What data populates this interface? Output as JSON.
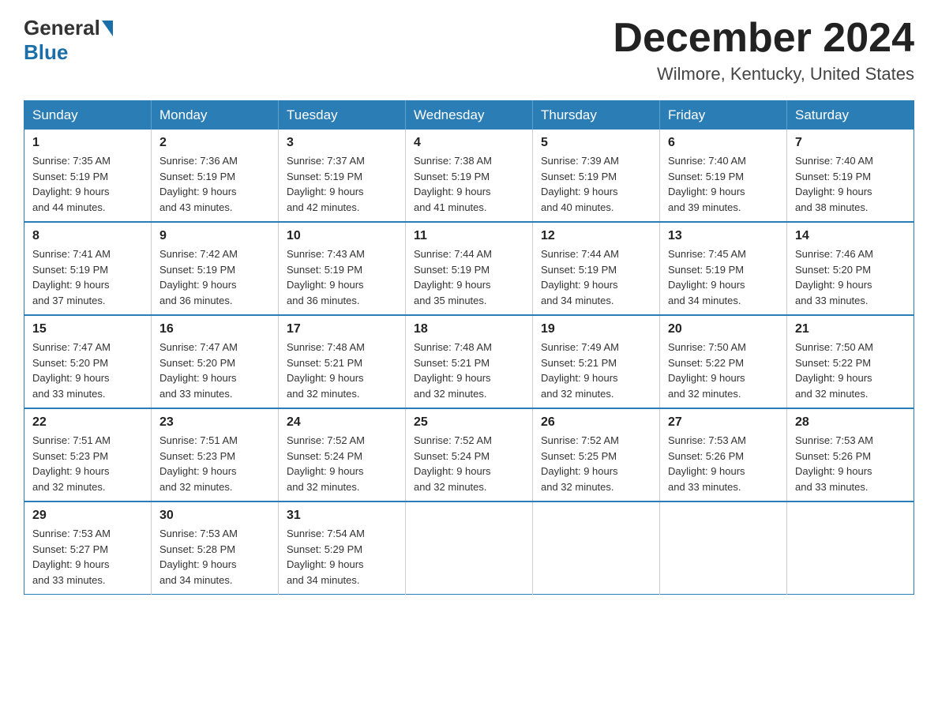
{
  "logo": {
    "general": "General",
    "blue": "Blue"
  },
  "title": {
    "month": "December 2024",
    "location": "Wilmore, Kentucky, United States"
  },
  "days_of_week": [
    "Sunday",
    "Monday",
    "Tuesday",
    "Wednesday",
    "Thursday",
    "Friday",
    "Saturday"
  ],
  "weeks": [
    [
      {
        "day": "1",
        "sunrise": "7:35 AM",
        "sunset": "5:19 PM",
        "daylight": "9 hours and 44 minutes."
      },
      {
        "day": "2",
        "sunrise": "7:36 AM",
        "sunset": "5:19 PM",
        "daylight": "9 hours and 43 minutes."
      },
      {
        "day": "3",
        "sunrise": "7:37 AM",
        "sunset": "5:19 PM",
        "daylight": "9 hours and 42 minutes."
      },
      {
        "day": "4",
        "sunrise": "7:38 AM",
        "sunset": "5:19 PM",
        "daylight": "9 hours and 41 minutes."
      },
      {
        "day": "5",
        "sunrise": "7:39 AM",
        "sunset": "5:19 PM",
        "daylight": "9 hours and 40 minutes."
      },
      {
        "day": "6",
        "sunrise": "7:40 AM",
        "sunset": "5:19 PM",
        "daylight": "9 hours and 39 minutes."
      },
      {
        "day": "7",
        "sunrise": "7:40 AM",
        "sunset": "5:19 PM",
        "daylight": "9 hours and 38 minutes."
      }
    ],
    [
      {
        "day": "8",
        "sunrise": "7:41 AM",
        "sunset": "5:19 PM",
        "daylight": "9 hours and 37 minutes."
      },
      {
        "day": "9",
        "sunrise": "7:42 AM",
        "sunset": "5:19 PM",
        "daylight": "9 hours and 36 minutes."
      },
      {
        "day": "10",
        "sunrise": "7:43 AM",
        "sunset": "5:19 PM",
        "daylight": "9 hours and 36 minutes."
      },
      {
        "day": "11",
        "sunrise": "7:44 AM",
        "sunset": "5:19 PM",
        "daylight": "9 hours and 35 minutes."
      },
      {
        "day": "12",
        "sunrise": "7:44 AM",
        "sunset": "5:19 PM",
        "daylight": "9 hours and 34 minutes."
      },
      {
        "day": "13",
        "sunrise": "7:45 AM",
        "sunset": "5:19 PM",
        "daylight": "9 hours and 34 minutes."
      },
      {
        "day": "14",
        "sunrise": "7:46 AM",
        "sunset": "5:20 PM",
        "daylight": "9 hours and 33 minutes."
      }
    ],
    [
      {
        "day": "15",
        "sunrise": "7:47 AM",
        "sunset": "5:20 PM",
        "daylight": "9 hours and 33 minutes."
      },
      {
        "day": "16",
        "sunrise": "7:47 AM",
        "sunset": "5:20 PM",
        "daylight": "9 hours and 33 minutes."
      },
      {
        "day": "17",
        "sunrise": "7:48 AM",
        "sunset": "5:21 PM",
        "daylight": "9 hours and 32 minutes."
      },
      {
        "day": "18",
        "sunrise": "7:48 AM",
        "sunset": "5:21 PM",
        "daylight": "9 hours and 32 minutes."
      },
      {
        "day": "19",
        "sunrise": "7:49 AM",
        "sunset": "5:21 PM",
        "daylight": "9 hours and 32 minutes."
      },
      {
        "day": "20",
        "sunrise": "7:50 AM",
        "sunset": "5:22 PM",
        "daylight": "9 hours and 32 minutes."
      },
      {
        "day": "21",
        "sunrise": "7:50 AM",
        "sunset": "5:22 PM",
        "daylight": "9 hours and 32 minutes."
      }
    ],
    [
      {
        "day": "22",
        "sunrise": "7:51 AM",
        "sunset": "5:23 PM",
        "daylight": "9 hours and 32 minutes."
      },
      {
        "day": "23",
        "sunrise": "7:51 AM",
        "sunset": "5:23 PM",
        "daylight": "9 hours and 32 minutes."
      },
      {
        "day": "24",
        "sunrise": "7:52 AM",
        "sunset": "5:24 PM",
        "daylight": "9 hours and 32 minutes."
      },
      {
        "day": "25",
        "sunrise": "7:52 AM",
        "sunset": "5:24 PM",
        "daylight": "9 hours and 32 minutes."
      },
      {
        "day": "26",
        "sunrise": "7:52 AM",
        "sunset": "5:25 PM",
        "daylight": "9 hours and 32 minutes."
      },
      {
        "day": "27",
        "sunrise": "7:53 AM",
        "sunset": "5:26 PM",
        "daylight": "9 hours and 33 minutes."
      },
      {
        "day": "28",
        "sunrise": "7:53 AM",
        "sunset": "5:26 PM",
        "daylight": "9 hours and 33 minutes."
      }
    ],
    [
      {
        "day": "29",
        "sunrise": "7:53 AM",
        "sunset": "5:27 PM",
        "daylight": "9 hours and 33 minutes."
      },
      {
        "day": "30",
        "sunrise": "7:53 AM",
        "sunset": "5:28 PM",
        "daylight": "9 hours and 34 minutes."
      },
      {
        "day": "31",
        "sunrise": "7:54 AM",
        "sunset": "5:29 PM",
        "daylight": "9 hours and 34 minutes."
      },
      null,
      null,
      null,
      null
    ]
  ],
  "labels": {
    "sunrise": "Sunrise:",
    "sunset": "Sunset:",
    "daylight": "Daylight:"
  }
}
